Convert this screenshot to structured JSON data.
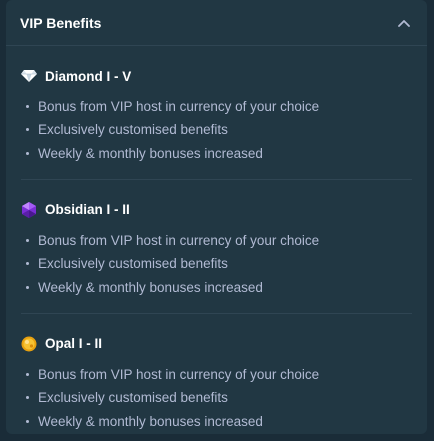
{
  "header": {
    "title": "VIP Benefits",
    "toggle_icon": "chevron-up-icon"
  },
  "tiers": [
    {
      "name": "Diamond I - V",
      "icon": "diamond-icon",
      "benefits": [
        "Bonus from VIP host in currency of your choice",
        "Exclusively customised benefits",
        "Weekly & monthly bonuses increased"
      ]
    },
    {
      "name": "Obsidian I - II",
      "icon": "obsidian-gem-icon",
      "benefits": [
        "Bonus from VIP host in currency of your choice",
        "Exclusively customised benefits",
        "Weekly & monthly bonuses increased"
      ]
    },
    {
      "name": "Opal I - II",
      "icon": "opal-gem-icon",
      "benefits": [
        "Bonus from VIP host in currency of your choice",
        "Exclusively customised benefits",
        "Weekly & monthly bonuses increased"
      ]
    }
  ],
  "colors": {
    "background": "#1a2c38",
    "panel": "#213743",
    "divider": "#2f4553",
    "muted_text": "#b1bad3"
  }
}
